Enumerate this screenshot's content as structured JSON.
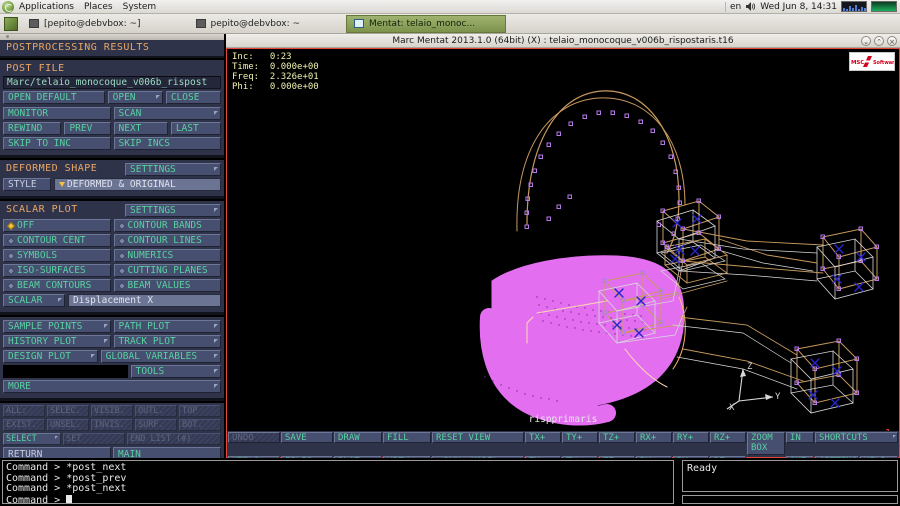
{
  "desktop": {
    "menus": [
      "Applications",
      "Places",
      "System"
    ],
    "tray": {
      "language": "en",
      "clock": "Wed Jun  8, 14:31",
      "speaker_icon": "speaker-icon",
      "cpu_monitor_icon": "cpu-monitor-icon",
      "network_monitor_icon": "network-monitor-icon"
    },
    "tasks": [
      {
        "label": "[pepito@debvbox: ~]",
        "active": false,
        "icon": "terminal-icon"
      },
      {
        "label": "pepito@debvbox: ~",
        "active": false,
        "icon": "terminal-icon"
      },
      {
        "label": "Mentat: telaio_monoc...",
        "active": true,
        "icon": "mentat-icon"
      }
    ]
  },
  "window": {
    "title": "Marc Mentat 2013.1.0 (64bit) (X) : telaio_monocoque_v006b_rispostaris.t16",
    "buttons": [
      {
        "name": "minimize-button",
        "glyph": "⌄"
      },
      {
        "name": "maximize-button",
        "glyph": "⌃"
      },
      {
        "name": "close-button",
        "glyph": "×"
      }
    ]
  },
  "panel": {
    "title": "POSTPROCESSING RESULTS",
    "post_file": {
      "title": "POST FILE",
      "path": "Marc/telaio_monocoque_v006b_rispost",
      "buttons": {
        "open_default": "OPEN DEFAULT",
        "open": "OPEN",
        "close": "CLOSE",
        "monitor": "MONITOR",
        "scan": "SCAN",
        "rewind": "REWIND",
        "prev": "PREV",
        "next": "NEXT",
        "last": "LAST",
        "skip_to_inc": "SKIP TO INC",
        "skip_incs": "SKIP INCS"
      }
    },
    "deformed_shape": {
      "title": "DEFORMED SHAPE",
      "settings": "SETTINGS",
      "style_label": "STYLE",
      "style_value": "DEFORMED & ORIGINAL"
    },
    "scalar_plot": {
      "title": "SCALAR PLOT",
      "settings": "SETTINGS",
      "options": [
        {
          "label": "OFF",
          "selected": true
        },
        {
          "label": "CONTOUR BANDS",
          "selected": false
        },
        {
          "label": "CONTOUR CENT",
          "selected": false
        },
        {
          "label": "CONTOUR LINES",
          "selected": false
        },
        {
          "label": "SYMBOLS",
          "selected": false
        },
        {
          "label": "NUMERICS",
          "selected": false
        },
        {
          "label": "ISO-SURFACES",
          "selected": false
        },
        {
          "label": "CUTTING PLANES",
          "selected": false
        },
        {
          "label": "BEAM CONTOURS",
          "selected": false
        },
        {
          "label": "BEAM VALUES",
          "selected": false
        }
      ],
      "scalar_label": "SCALAR",
      "scalar_value": "Displacement X"
    },
    "plots": {
      "sample_points": "SAMPLE POINTS",
      "path_plot": "PATH PLOT",
      "history_plot": "HISTORY PLOT",
      "track_plot": "TRACK PLOT",
      "design_plot": "DESIGN PLOT",
      "global_variables": "GLOBAL VARIABLES",
      "tools": "TOOLS",
      "more": "MORE"
    },
    "selector": {
      "row1": [
        {
          "label": "ALL:",
          "enabled": false
        },
        {
          "label": "SELEC.",
          "enabled": false
        },
        {
          "label": "VISIB.",
          "enabled": false
        },
        {
          "label": "OUTL.",
          "enabled": false
        },
        {
          "label": "TOP",
          "enabled": false
        }
      ],
      "row2": [
        {
          "label": "EXIST.",
          "enabled": false
        },
        {
          "label": "UNSEL.",
          "enabled": false
        },
        {
          "label": "INVIS.",
          "enabled": false
        },
        {
          "label": "SURF.",
          "enabled": false
        },
        {
          "label": "BOT.",
          "enabled": false
        }
      ],
      "row3": [
        {
          "label": "SELECT",
          "enabled": true
        },
        {
          "label": "SET",
          "enabled": false
        },
        {
          "label": "END LIST (#)",
          "enabled": false
        }
      ],
      "return": "RETURN",
      "main": "MAIN"
    }
  },
  "viewport": {
    "info": "Inc:   0:23\nTime:  0.000e+00\nFreq:  2.326e+01\nPhi:   0.000e+00",
    "info_rows": [
      {
        "label": "Inc:",
        "value": "0:23"
      },
      {
        "label": "Time:",
        "value": "0.000e+00"
      },
      {
        "label": "Freq:",
        "value": "2.326e+01"
      },
      {
        "label": "Phi:",
        "value": "0.000e+00"
      }
    ],
    "logo_text": "MSC Software",
    "model_name": "rispprimaris",
    "view_number": "1",
    "triad_labels": {
      "x": "X",
      "y": "Y",
      "z": "Z"
    },
    "colors": {
      "background": "#000000",
      "shell_magenta": "#e36ff0",
      "wire_tan": "#c89a5e",
      "wire_white": "#d8d8d8",
      "node_violet": "#b67ae8",
      "marker_blue": "#2626cc",
      "highlight_red": "#e8453c"
    }
  },
  "vp_toolbar": {
    "row1": [
      {
        "label": "UNDO",
        "disabled": true
      },
      {
        "label": "SAVE",
        "disabled": false
      },
      {
        "label": "DRAW",
        "disabled": false
      },
      {
        "label": "FILL",
        "disabled": false
      },
      {
        "label": "RESET VIEW",
        "disabled": false
      },
      {
        "label": "TX+",
        "disabled": false
      },
      {
        "label": "TY+",
        "disabled": false
      },
      {
        "label": "TZ+",
        "disabled": false
      },
      {
        "label": "RX+",
        "disabled": false
      },
      {
        "label": "RY+",
        "disabled": false
      },
      {
        "label": "RZ+",
        "disabled": false
      }
    ],
    "row2": [
      {
        "label": "UTILS",
        "disabled": false
      },
      {
        "label": "FILES",
        "disabled": false
      },
      {
        "label": "PLOT",
        "disabled": false
      },
      {
        "label": "VIEW",
        "disabled": false
      },
      {
        "label": "DYN. MODEL",
        "disabled": false
      },
      {
        "label": "TX-",
        "disabled": false
      },
      {
        "label": "TY-",
        "disabled": false
      },
      {
        "label": "TZ-",
        "disabled": false
      },
      {
        "label": "RX-",
        "disabled": false
      },
      {
        "label": "RY-",
        "disabled": false
      },
      {
        "label": "RZ-",
        "disabled": false
      }
    ],
    "zoom_box": "ZOOM BOX",
    "zoom_in": "IN",
    "zoom_out": "OUT",
    "shortcuts": "SHORTCUTS",
    "settings": "SETTINGS",
    "help": "HELP"
  },
  "console": {
    "lines": [
      "Command > *post_next",
      "Command > *post_prev",
      "Command > *post_next"
    ],
    "prompt": "Command > ",
    "status": "Ready"
  }
}
